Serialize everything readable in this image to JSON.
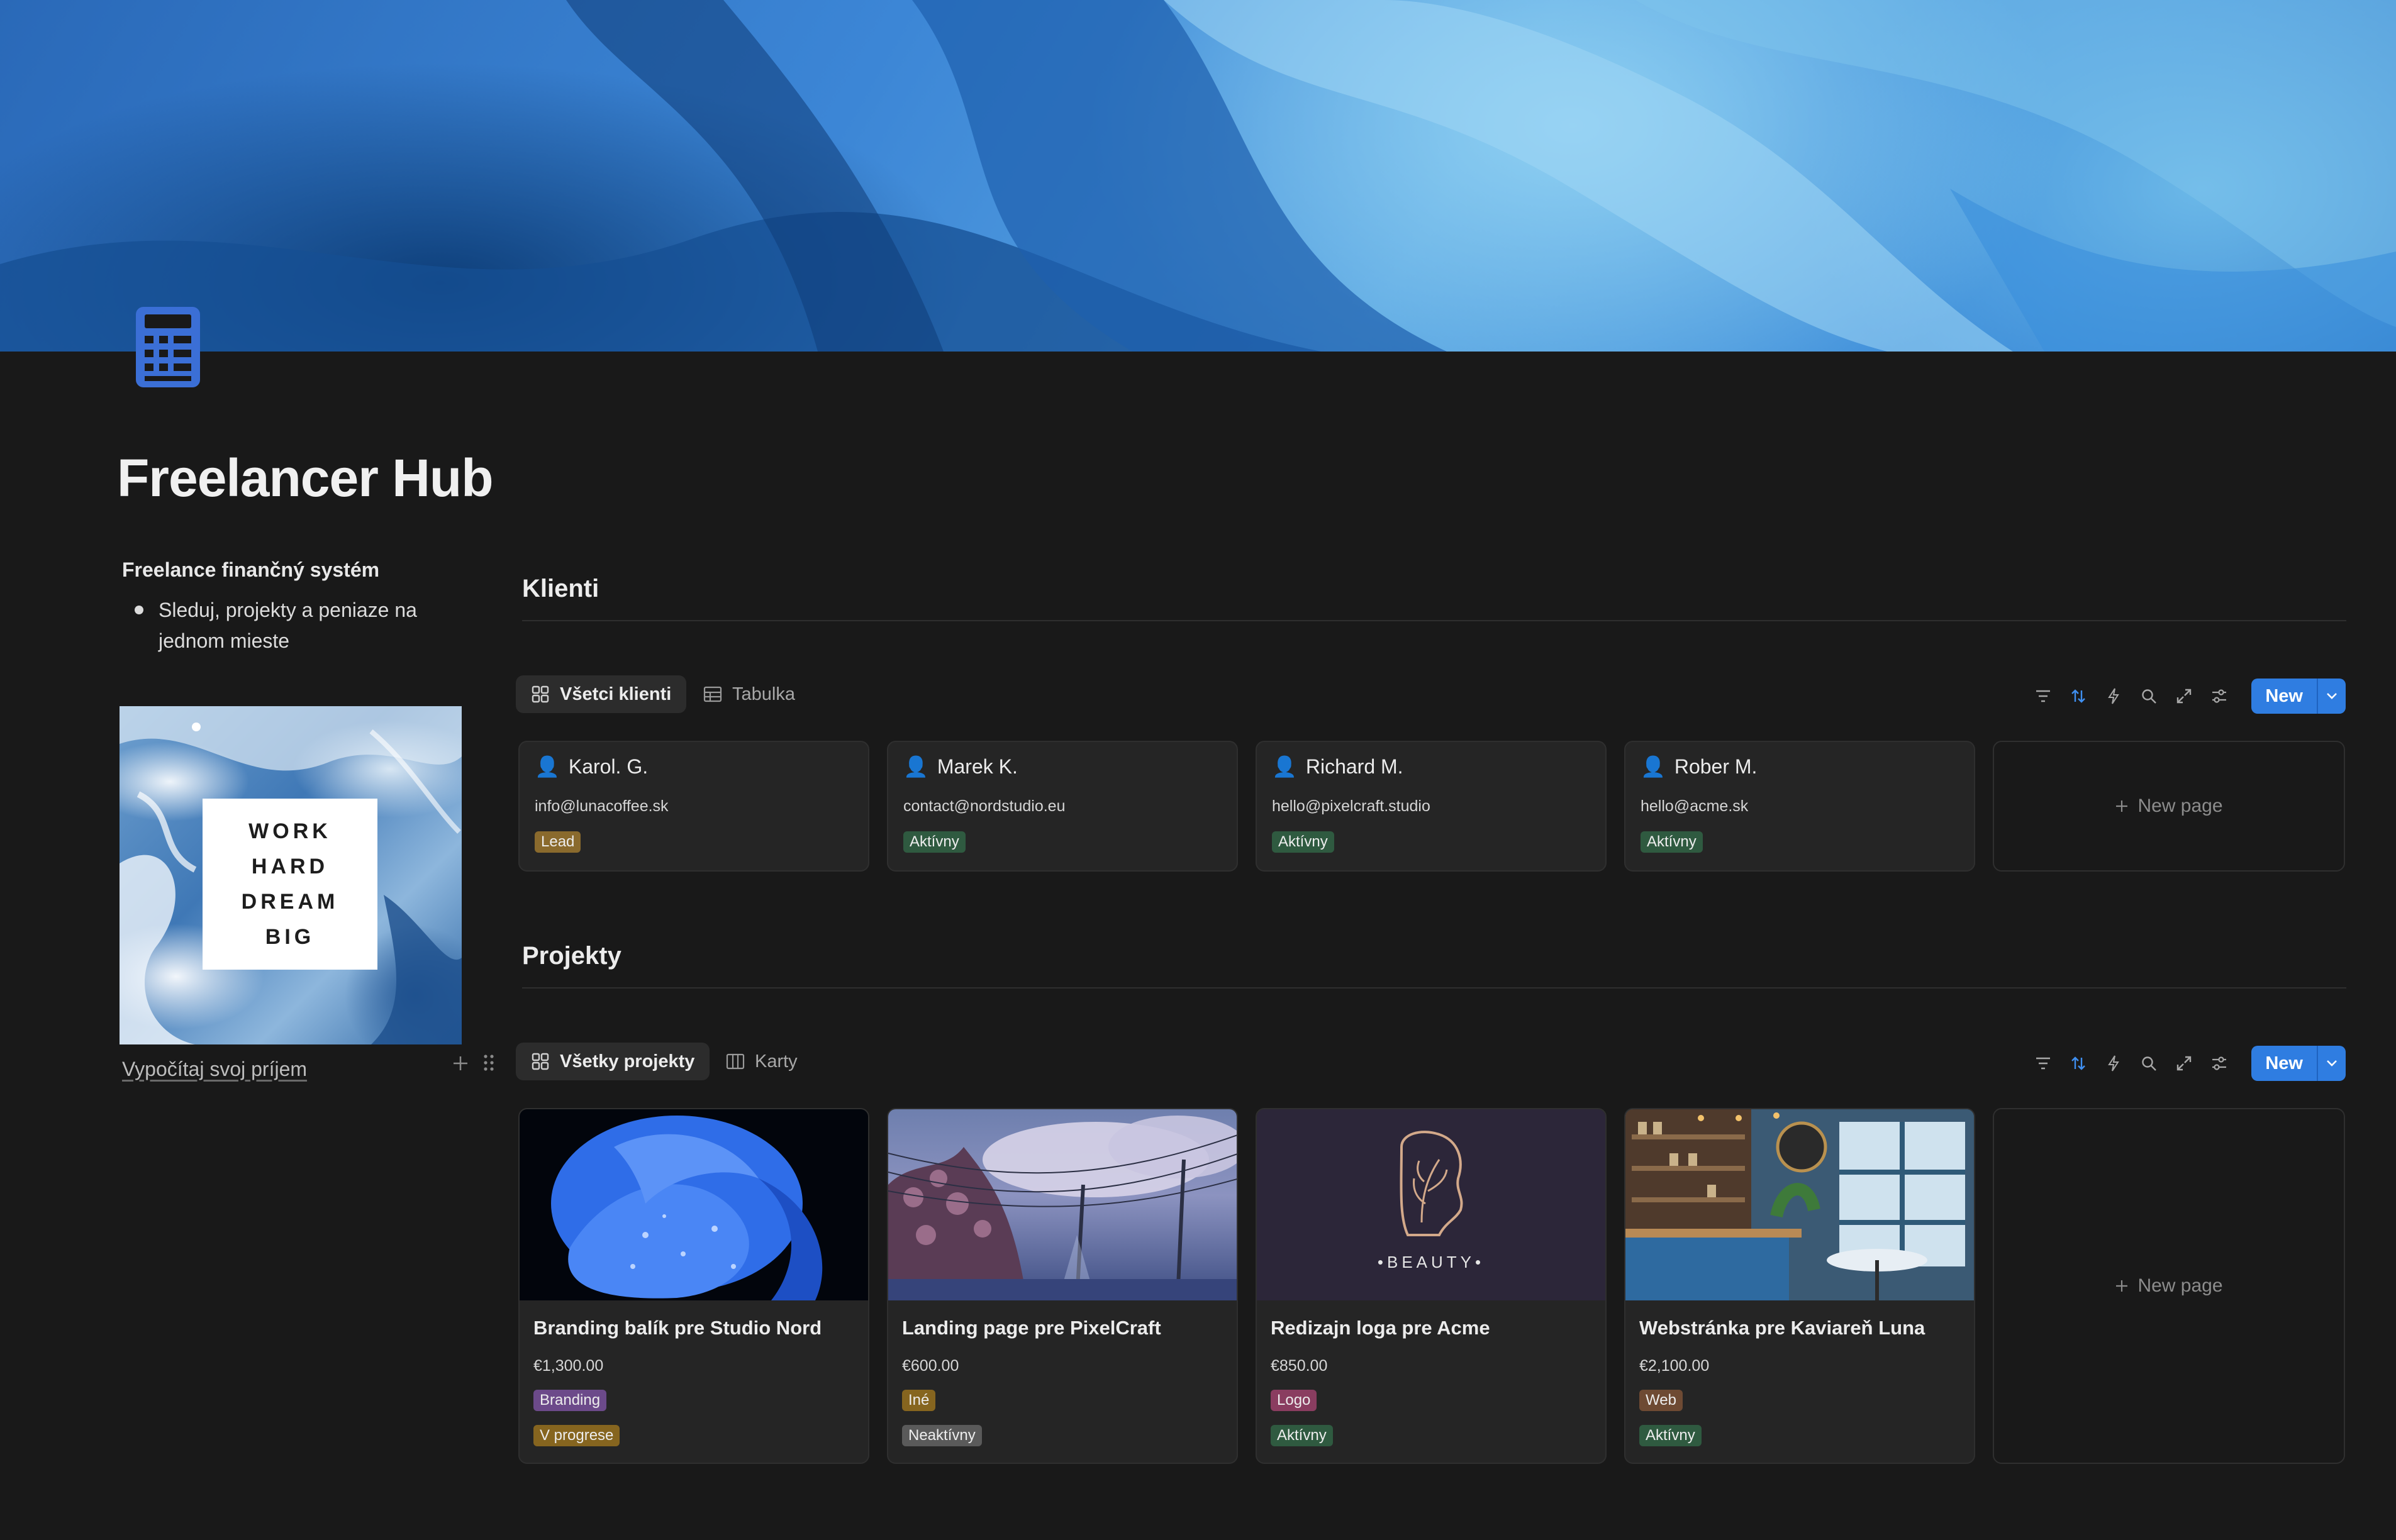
{
  "page": {
    "title": "Freelancer Hub",
    "icon": "calculator-icon"
  },
  "sidebar": {
    "heading": "Freelance finančný systém",
    "bullet": "Sleduj, projekty a peniaze na jednom mieste",
    "image_text": [
      "WORK",
      "HARD",
      "DREAM",
      "BIG"
    ],
    "link": "Vypočítaj svoj príjem"
  },
  "clients": {
    "title": "Klienti",
    "views": [
      "Všetci klienti",
      "Tabulka"
    ],
    "new_label": "New",
    "new_page_label": "New page",
    "cards": [
      {
        "name": "Karol. G.",
        "email": "info@lunacoffee.sk",
        "status": "Lead"
      },
      {
        "name": "Marek K.",
        "email": "contact@nordstudio.eu",
        "status": "Aktívny"
      },
      {
        "name": "Richard M.",
        "email": "hello@pixelcraft.studio",
        "status": "Aktívny"
      },
      {
        "name": "Rober M.",
        "email": "hello@acme.sk",
        "status": "Aktívny"
      }
    ]
  },
  "projects": {
    "title": "Projekty",
    "views": [
      "Všetky projekty",
      "Karty"
    ],
    "new_label": "New",
    "new_page_label": "New page",
    "cards": [
      {
        "title": "Branding balík pre Studio Nord",
        "price": "€1,300.00",
        "category": "Branding",
        "status": "V progrese"
      },
      {
        "title": "Landing page pre PixelCraft",
        "price": "€600.00",
        "category": "Iné",
        "status": "Neaktívny"
      },
      {
        "title": "Redizajn loga pre Acme",
        "price": "€850.00",
        "category": "Logo",
        "status": "Aktívny",
        "image_text": "•BEAUTY•"
      },
      {
        "title": "Webstránka pre Kaviareň Luna",
        "price": "€2,100.00",
        "category": "Web",
        "status": "Aktívny"
      }
    ]
  },
  "colors": {
    "background": "#191919",
    "accent": "#2f7de1",
    "card": "#252525"
  }
}
